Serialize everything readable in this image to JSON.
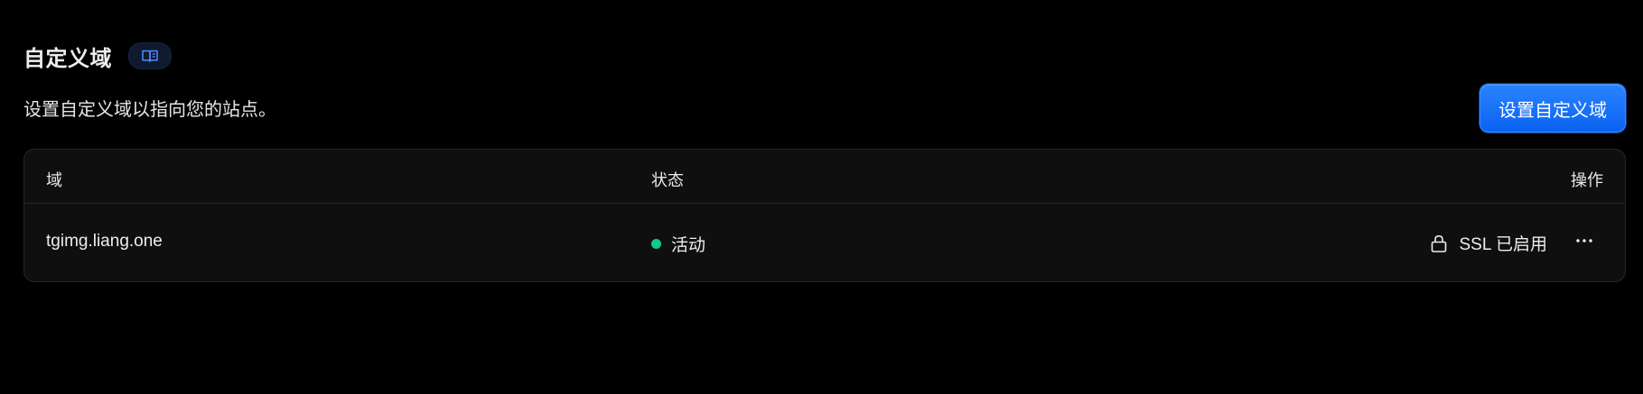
{
  "header": {
    "title": "自定义域",
    "doc_icon": "book-open-icon",
    "subtitle": "设置自定义域以指向您的站点。",
    "primary_button_label": "设置自定义域"
  },
  "table": {
    "columns": [
      "域",
      "状态",
      "操作"
    ],
    "rows": [
      {
        "domain": "tgimg.liang.one",
        "status": "活动",
        "ssl": "SSL 已启用",
        "actions_icon": "more-horizontal-icon"
      }
    ]
  },
  "colors": {
    "background": "#000000",
    "accent": "#0a62f0",
    "status_active": "#10c98a"
  }
}
